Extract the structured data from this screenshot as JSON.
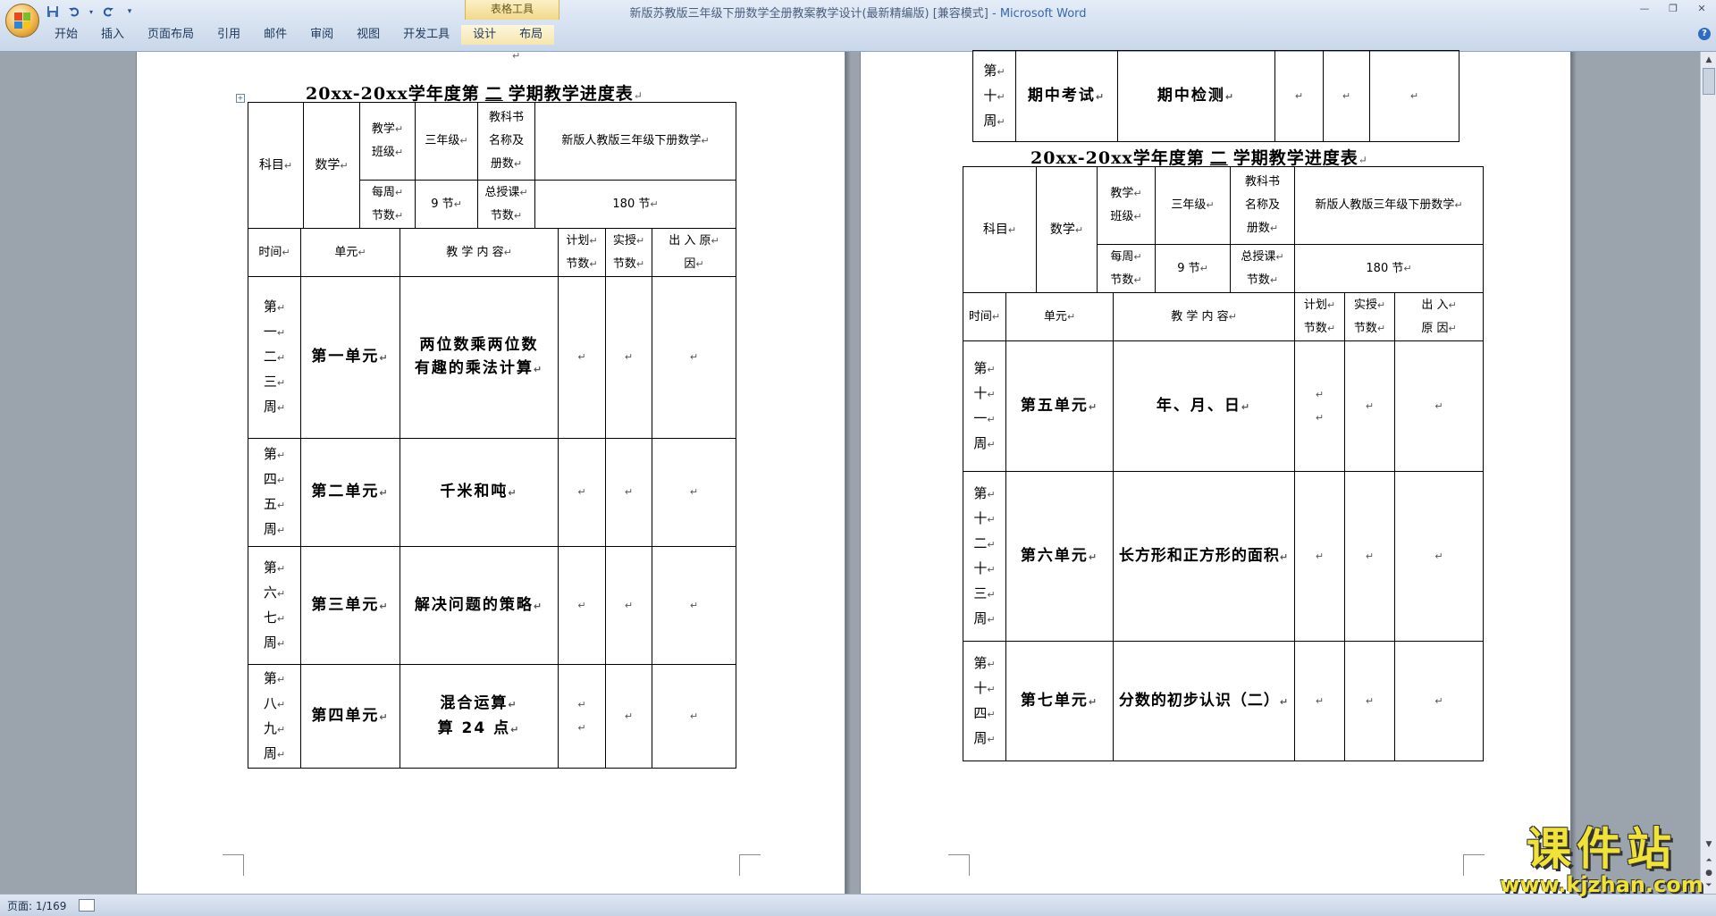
{
  "window": {
    "title": "新版苏教版三年级下册数学全册教案教学设计(最新精编版) [兼容模式]",
    "app_suffix": " - Microsoft Word",
    "context_tab_group": "表格工具"
  },
  "ribbon": {
    "tabs": [
      "开始",
      "插入",
      "页面布局",
      "引用",
      "邮件",
      "审阅",
      "视图",
      "开发工具",
      "设计",
      "布局"
    ]
  },
  "status": {
    "page": "页面: 1/169"
  },
  "watermark": {
    "main": "课件站",
    "url": "www.kjzhan.com"
  },
  "icons": {
    "office_button": "office-logo-icon",
    "save": "save-icon",
    "undo": "undo-icon",
    "redo": "redo-icon",
    "customize": "dropdown-icon",
    "minimize": "minimize-icon",
    "maximize": "maximize-icon",
    "close": "close-icon",
    "help": "help-icon"
  },
  "mark": "↵",
  "page1": {
    "title": {
      "prefix": "20xx-20xx",
      "mid": "学年度第",
      "term": "二",
      "suffix": "学期教学进度表"
    },
    "header": {
      "subject_label": "科目",
      "subject_value": "数学",
      "class_label": [
        "教学",
        "班级"
      ],
      "class_value": "三年级",
      "book_label": [
        "教科书",
        "名称及",
        "册数"
      ],
      "book_value": "新版人教版三年级下册数学",
      "weekly_label": [
        "每周",
        "节数"
      ],
      "weekly_value": "9 节",
      "total_label": [
        "总授课",
        "节数"
      ],
      "total_value": "180 节"
    },
    "columns": {
      "time": "时间",
      "unit": "单元",
      "content": "教 学 内 容",
      "plan": [
        "计划",
        "节数"
      ],
      "actual": [
        "实授",
        "节数"
      ],
      "reason": [
        "出 入 原",
        "因"
      ]
    },
    "rows": [
      {
        "weeks": [
          "第",
          "一",
          "二",
          "三",
          "周"
        ],
        "unit": "第一单元",
        "content": [
          "两位数乘两位数",
          "有趣的乘法计算"
        ]
      },
      {
        "weeks": [
          "第",
          "四",
          "五",
          "周"
        ],
        "unit": "第二单元",
        "content": [
          "千米和吨"
        ]
      },
      {
        "weeks": [
          "第",
          "六",
          "七",
          "周"
        ],
        "unit": "第三单元",
        "content": [
          "解决问题的策略"
        ]
      },
      {
        "weeks": [
          "第",
          "八",
          "九",
          "周"
        ],
        "unit": "第四单元",
        "content": [
          "混合运算",
          "算 24 点"
        ]
      }
    ]
  },
  "page2": {
    "top_fragment": {
      "weeks": [
        "第",
        "十",
        "周"
      ],
      "unit": "期中考试",
      "content": "期中检测"
    },
    "title": {
      "prefix": "20xx-20xx",
      "mid": "学年度第",
      "term": "二",
      "suffix": "学期教学进度表"
    },
    "header": {
      "subject_label": "科目",
      "subject_value": "数学",
      "class_label": [
        "教学",
        "班级"
      ],
      "class_value": "三年级",
      "book_label": [
        "教科书",
        "名称及",
        "册数"
      ],
      "book_value": "新版人教版三年级下册数学",
      "weekly_label": [
        "每周",
        "节数"
      ],
      "weekly_value": "9 节",
      "total_label": [
        "总授课",
        "节数"
      ],
      "total_value": "180 节"
    },
    "columns": {
      "time": "时间",
      "unit": "单元",
      "content": "教 学 内 容",
      "plan": [
        "计划",
        "节数"
      ],
      "actual": [
        "实授",
        "节数"
      ],
      "reason": [
        "出 入",
        "原 因"
      ]
    },
    "rows": [
      {
        "weeks": [
          "第",
          "十",
          "一",
          "周"
        ],
        "unit": "第五单元",
        "content": [
          "年、月、日"
        ]
      },
      {
        "weeks": [
          "第",
          "十",
          "二",
          "十",
          "三",
          "周"
        ],
        "unit": "第六单元",
        "content": [
          "长方形和正方形的面积"
        ]
      },
      {
        "weeks": [
          "第",
          "十",
          "四",
          "周"
        ],
        "unit": "第七单元",
        "content": [
          "分数的初步认识（二）"
        ]
      }
    ]
  }
}
